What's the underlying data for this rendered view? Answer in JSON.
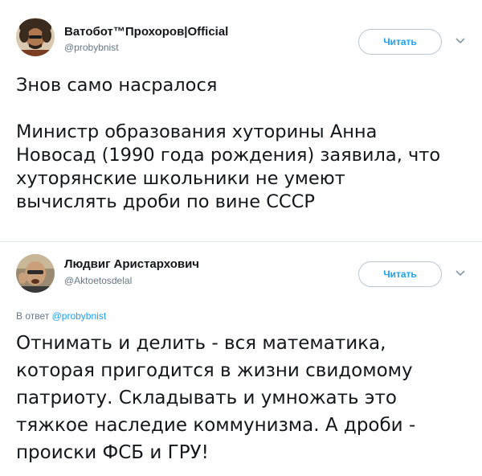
{
  "tweets": [
    {
      "author_name": "Ватобот™Прохоров|Official",
      "author_handle": "@probybnist",
      "follow_label": "Читать",
      "text": "Знов само насралося\n\nМинистр образования хуторины Анна\nНовосад (1990 года рождения) заявила, что\nхуторянские школьники не умеют\nвычислять дроби по вине СССР"
    },
    {
      "author_name": "Людвиг Аристархович",
      "author_handle": "@Aktoetosdelal",
      "follow_label": "Читать",
      "reply_prefix": "В ответ",
      "reply_handle": "@probybnist",
      "text": "Отнимать и делить - вся математика,\nкоторая пригодится в жизни свидомому\nпатриоту. Складывать и умножать это\nтяжкое наследие коммунизма. А дроби -\nпроиски ФСБ и ГРУ!"
    }
  ],
  "colors": {
    "link": "#1da1f2",
    "secondary_text": "#657786",
    "primary_text": "#14171a",
    "divider": "#e6ecf0"
  }
}
